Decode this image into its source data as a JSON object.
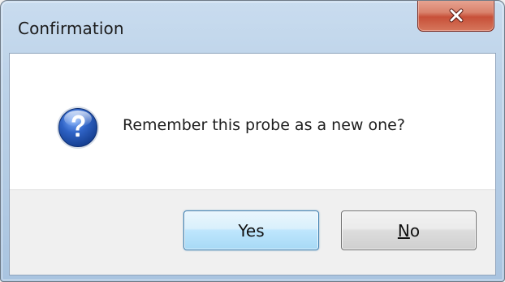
{
  "window": {
    "title": "Confirmation",
    "close_icon": "close-icon"
  },
  "message": {
    "icon": "question-icon",
    "text": "Remember this probe as a new one?"
  },
  "buttons": {
    "yes_label": "Yes",
    "no_mnemonic": "N",
    "no_rest": "o"
  },
  "colors": {
    "titlebar": "#bcd2e8",
    "close_button": "#c75039",
    "question_icon": "#1f4fa8",
    "default_button_border": "#3c7fb1",
    "button_bar": "#f0f0f0"
  }
}
